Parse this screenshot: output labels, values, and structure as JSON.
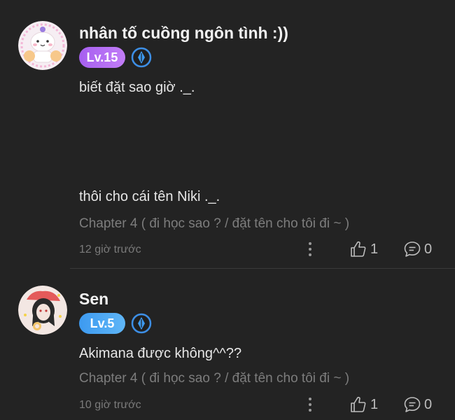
{
  "comments": [
    {
      "username": "nhân tố cuồng ngôn tình :))",
      "level": "Lv.15",
      "text_line1": "biết đặt sao giờ ._.",
      "text_line2": "thôi cho cái tên Niki ._.",
      "chapter": "Chapter 4 ( đi học sao ? / đặt tên cho tôi đi ~ )",
      "time": "12 giờ trước",
      "likes": "1",
      "replies": "0",
      "level_color": "#b06ef3"
    },
    {
      "username": "Sen",
      "level": "Lv.5",
      "text_line1": "Akimana được không^^??",
      "chapter": "Chapter 4 ( đi học sao ? / đặt tên cho tôi đi ~ )",
      "time": "10 giờ trước",
      "likes": "1",
      "replies": "0",
      "level_color": "#4aa6f4"
    }
  ]
}
